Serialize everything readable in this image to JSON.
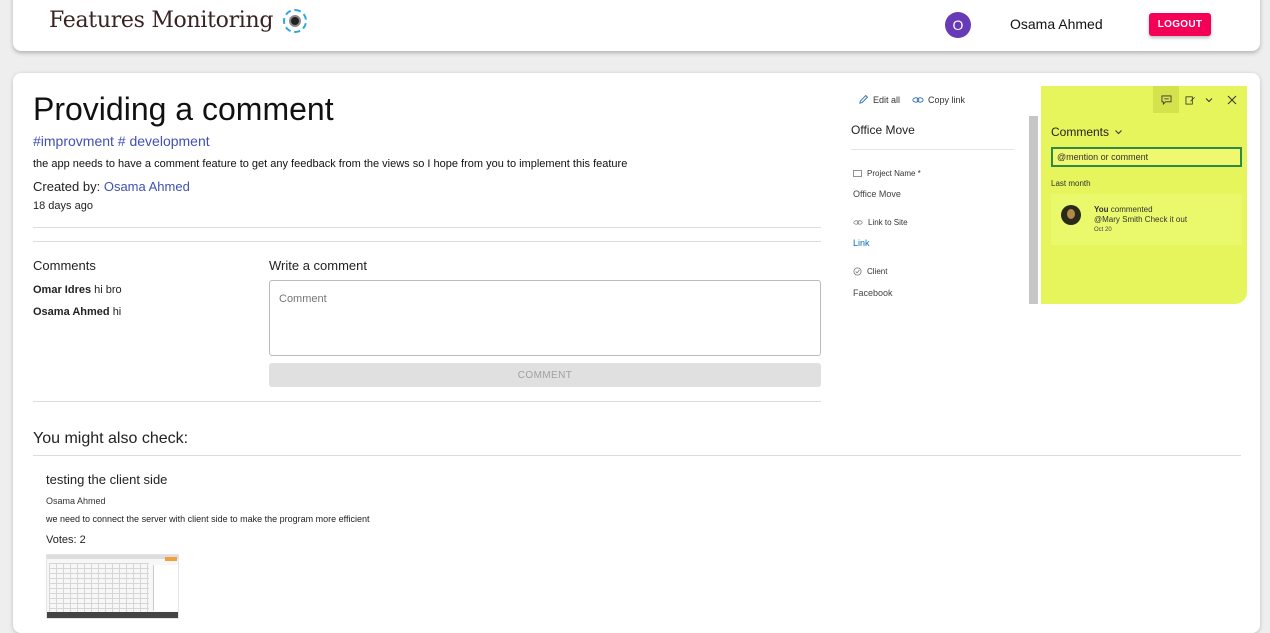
{
  "appbar": {
    "brand": "Features Monitoring",
    "avatar_initial": "O",
    "username": "Osama Ahmed",
    "logout_label": "LOGOUT"
  },
  "feature": {
    "title": "Providing a comment",
    "tags": "#improvment # development",
    "description": "the app needs to have a comment feature to get any feedback from the views so I hope from you to implement this feature",
    "created_by_label": "Created by:",
    "author": "Osama Ahmed",
    "age": "18 days ago"
  },
  "comments": {
    "heading": "Comments",
    "items": [
      {
        "user": "Omar Idres",
        "text": "hi bro"
      },
      {
        "user": "Osama Ahmed",
        "text": "hi"
      }
    ]
  },
  "write_comment": {
    "heading": "Write a comment",
    "placeholder": "Comment",
    "button_label": "COMMENT"
  },
  "related": {
    "heading": "You might also check:",
    "items": [
      {
        "title": "testing the client side",
        "author": "Osama Ahmed",
        "description": "we need to connect the server with client side to make the program more efficient",
        "votes": "Votes: 2"
      }
    ]
  },
  "attachment_panel": {
    "toolbar": {
      "edit_all": "Edit all",
      "copy_link": "Copy link"
    },
    "section_title": "Office Move",
    "fields": [
      {
        "label": "Project Name *",
        "value": "Office Move"
      },
      {
        "label": "Link to Site",
        "value": "Link"
      },
      {
        "label": "Client",
        "value": "Facebook"
      }
    ],
    "comments_pane": {
      "title": "Comments",
      "mention_placeholder": "@mention or comment",
      "group_label": "Last month",
      "entry": {
        "who": "You",
        "action": "commented",
        "text": "@Mary Smith Check it out",
        "date": "Oct 20"
      },
      "highlight_color": "#e6f55c"
    }
  },
  "colors": {
    "accent": "#3f51b5",
    "logout": "#f50057",
    "avatar": "#673ab7"
  }
}
